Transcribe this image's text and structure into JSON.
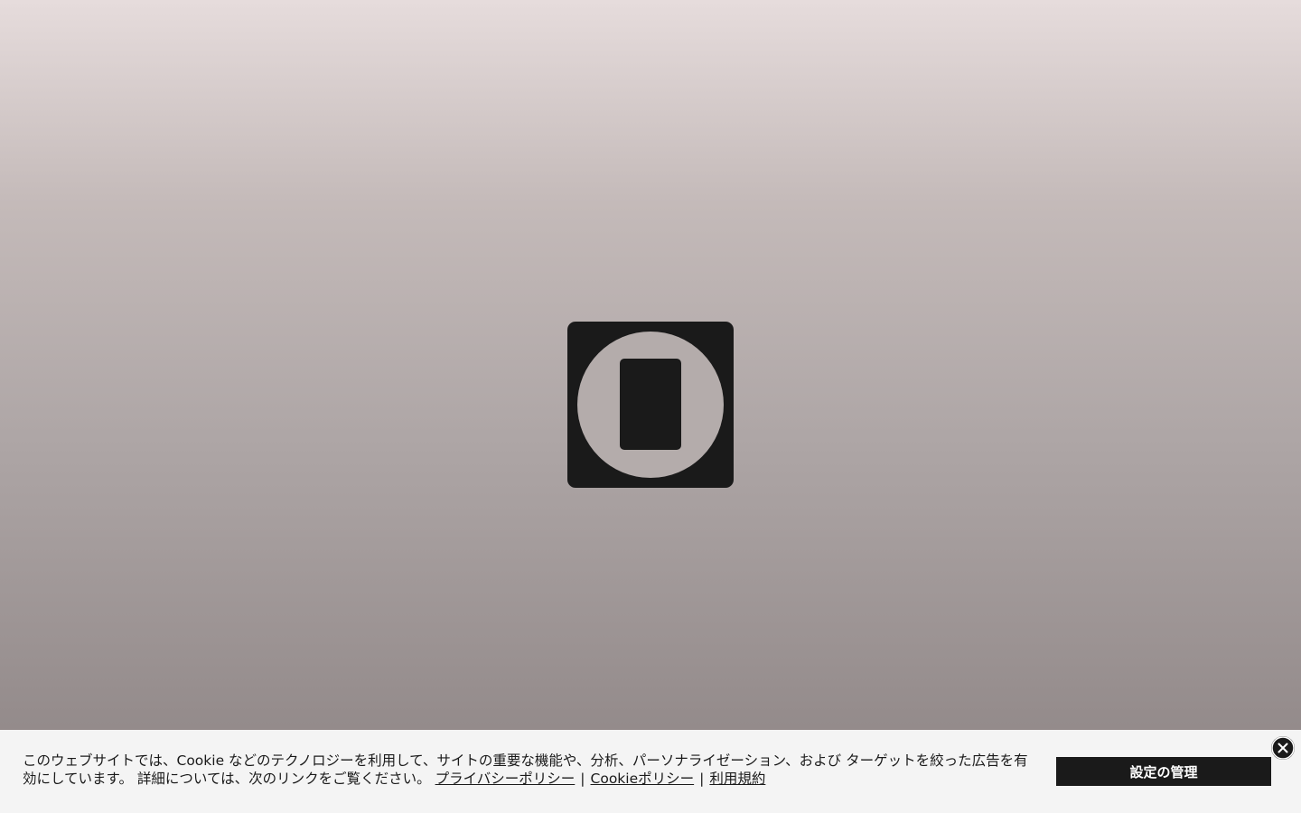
{
  "logo": {
    "icon": "brand-logo-icon",
    "color": "#1a1a1a"
  },
  "cookie_banner": {
    "message": "このウェブサイトでは、Cookie などのテクノロジーを利用して、サイトの重要な機能や、分析、パーソナライゼーション、および ターゲットを絞った広告を有効にしています。 詳細については、次のリンクをご覧ください。",
    "links": {
      "privacy_policy": "プライバシーポリシー",
      "cookie_policy": "Cookieポリシー",
      "terms": "利用規約"
    },
    "separator": "|",
    "manage_button": "設定の管理",
    "close_icon": "close-icon"
  },
  "colors": {
    "banner_bg": "#f4f4f4",
    "button_bg": "#1a1a1a",
    "button_text": "#ffffff"
  }
}
